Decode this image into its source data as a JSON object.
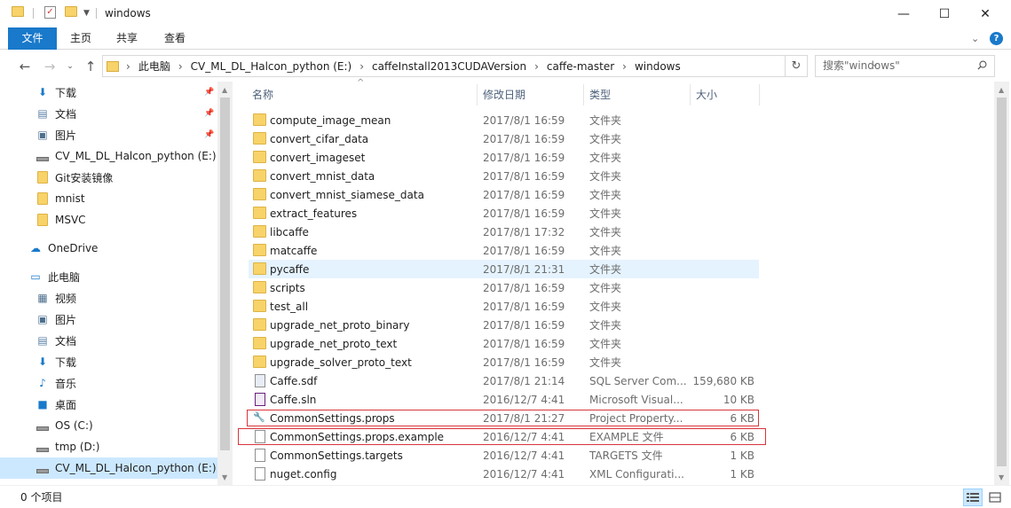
{
  "window": {
    "title": "windows",
    "minimize": "—",
    "maximize": "☐",
    "close": "✕"
  },
  "ribbon": {
    "tabs": [
      "文件",
      "主页",
      "共享",
      "查看"
    ]
  },
  "address": {
    "crumbs": [
      "此电脑",
      "CV_ML_DL_Halcon_python (E:)",
      "caffeInstall2013CUDAVersion",
      "caffe-master",
      "windows"
    ]
  },
  "search": {
    "placeholder": "搜索\"windows\""
  },
  "nav": {
    "items": [
      {
        "label": "下载",
        "icon": "download-arrow-icon",
        "pinned": true
      },
      {
        "label": "文档",
        "icon": "document-icon",
        "pinned": true
      },
      {
        "label": "图片",
        "icon": "picture-icon",
        "pinned": true
      },
      {
        "label": "CV_ML_DL_Halcon_python (E:)",
        "icon": "drive-icon",
        "pinned": false
      },
      {
        "label": "Git安装镜像",
        "icon": "folder-icon",
        "pinned": false
      },
      {
        "label": "mnist",
        "icon": "folder-icon",
        "pinned": false
      },
      {
        "label": "MSVC",
        "icon": "folder-icon",
        "pinned": false
      },
      {
        "label": "OneDrive",
        "icon": "cloud-icon",
        "pinned": false
      },
      {
        "label": "此电脑",
        "icon": "computer-icon",
        "pinned": false
      },
      {
        "label": "视频",
        "icon": "video-icon",
        "pinned": false
      },
      {
        "label": "图片",
        "icon": "picture-icon",
        "pinned": false
      },
      {
        "label": "文档",
        "icon": "document-icon",
        "pinned": false
      },
      {
        "label": "下载",
        "icon": "download-arrow-icon",
        "pinned": false
      },
      {
        "label": "音乐",
        "icon": "music-icon",
        "pinned": false
      },
      {
        "label": "桌面",
        "icon": "desktop-icon",
        "pinned": false
      },
      {
        "label": "OS (C:)",
        "icon": "drive-icon",
        "pinned": false
      },
      {
        "label": "tmp (D:)",
        "icon": "drive-icon",
        "pinned": false
      },
      {
        "label": "CV_ML_DL_Halcon_python (E:)",
        "icon": "drive-icon",
        "pinned": false
      }
    ]
  },
  "columns": {
    "name": "名称",
    "date": "修改日期",
    "type": "类型",
    "size": "大小"
  },
  "files": [
    {
      "name": "compute_image_mean",
      "date": "2017/8/1 16:59",
      "type": "文件夹",
      "size": "",
      "icon": "folder-icon"
    },
    {
      "name": "convert_cifar_data",
      "date": "2017/8/1 16:59",
      "type": "文件夹",
      "size": "",
      "icon": "folder-icon"
    },
    {
      "name": "convert_imageset",
      "date": "2017/8/1 16:59",
      "type": "文件夹",
      "size": "",
      "icon": "folder-icon"
    },
    {
      "name": "convert_mnist_data",
      "date": "2017/8/1 16:59",
      "type": "文件夹",
      "size": "",
      "icon": "folder-icon"
    },
    {
      "name": "convert_mnist_siamese_data",
      "date": "2017/8/1 16:59",
      "type": "文件夹",
      "size": "",
      "icon": "folder-icon"
    },
    {
      "name": "extract_features",
      "date": "2017/8/1 16:59",
      "type": "文件夹",
      "size": "",
      "icon": "folder-icon"
    },
    {
      "name": "libcaffe",
      "date": "2017/8/1 17:32",
      "type": "文件夹",
      "size": "",
      "icon": "folder-icon"
    },
    {
      "name": "matcaffe",
      "date": "2017/8/1 16:59",
      "type": "文件夹",
      "size": "",
      "icon": "folder-icon"
    },
    {
      "name": "pycaffe",
      "date": "2017/8/1 21:31",
      "type": "文件夹",
      "size": "",
      "icon": "folder-icon"
    },
    {
      "name": "scripts",
      "date": "2017/8/1 16:59",
      "type": "文件夹",
      "size": "",
      "icon": "folder-icon"
    },
    {
      "name": "test_all",
      "date": "2017/8/1 16:59",
      "type": "文件夹",
      "size": "",
      "icon": "folder-icon"
    },
    {
      "name": "upgrade_net_proto_binary",
      "date": "2017/8/1 16:59",
      "type": "文件夹",
      "size": "",
      "icon": "folder-icon"
    },
    {
      "name": "upgrade_net_proto_text",
      "date": "2017/8/1 16:59",
      "type": "文件夹",
      "size": "",
      "icon": "folder-icon"
    },
    {
      "name": "upgrade_solver_proto_text",
      "date": "2017/8/1 16:59",
      "type": "文件夹",
      "size": "",
      "icon": "folder-icon"
    },
    {
      "name": "Caffe.sdf",
      "date": "2017/8/1 21:14",
      "type": "SQL Server Com...",
      "size": "159,680 KB",
      "icon": "database-file-icon"
    },
    {
      "name": "Caffe.sln",
      "date": "2016/12/7 4:41",
      "type": "Microsoft Visual...",
      "size": "10 KB",
      "icon": "solution-file-icon"
    },
    {
      "name": "CommonSettings.props",
      "date": "2017/8/1 21:27",
      "type": "Project Property...",
      "size": "6 KB",
      "icon": "wrench-file-icon"
    },
    {
      "name": "CommonSettings.props.example",
      "date": "2016/12/7 4:41",
      "type": "EXAMPLE 文件",
      "size": "6 KB",
      "icon": "blank-file-icon"
    },
    {
      "name": "CommonSettings.targets",
      "date": "2016/12/7 4:41",
      "type": "TARGETS 文件",
      "size": "1 KB",
      "icon": "blank-file-icon"
    },
    {
      "name": "nuget.config",
      "date": "2016/12/7 4:41",
      "type": "XML Configurati...",
      "size": "1 KB",
      "icon": "config-file-icon"
    }
  ],
  "status": {
    "text": "0 个项目"
  }
}
